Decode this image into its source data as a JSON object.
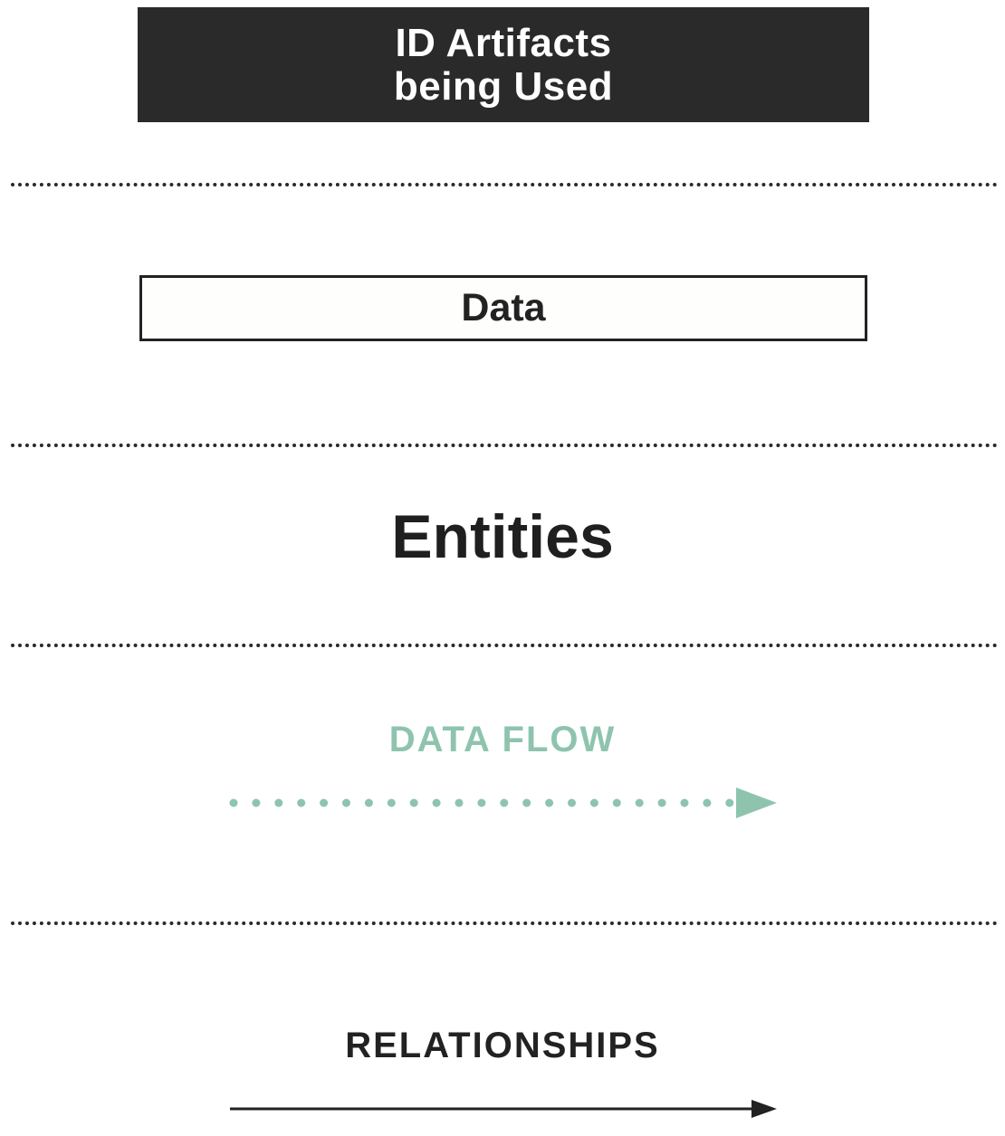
{
  "legend": {
    "artifact_box": {
      "title": "ID Artifacts\nbeing Used",
      "fill_color": "#2a2a2a",
      "text_color": "#ffffff"
    },
    "data_box": {
      "label": "Data",
      "border_color": "#222222"
    },
    "entities": {
      "label": "Entities"
    },
    "data_flow": {
      "label": "DATA FLOW",
      "color": "#8ec4ae",
      "line_style": "dotted",
      "arrow_icon": "arrow-right-icon"
    },
    "relationships": {
      "label": "RELATIONSHIPS",
      "color": "#222222",
      "line_style": "solid",
      "arrow_icon": "arrow-right-icon"
    },
    "separator_color": "#2a2a2a"
  }
}
